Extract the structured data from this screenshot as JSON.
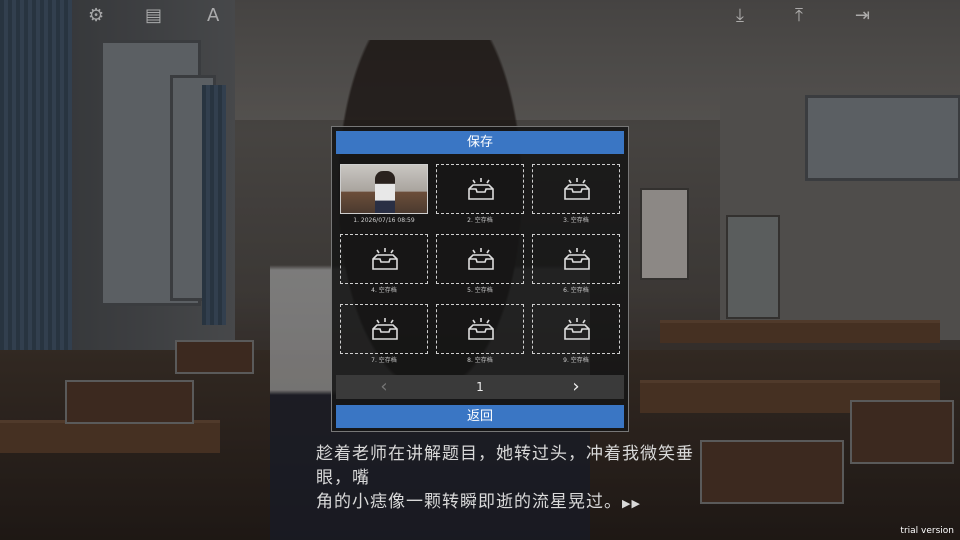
{
  "toolbar": {
    "left_icons": [
      "gear-icon",
      "message-log-icon",
      "font-icon"
    ],
    "right_icons": [
      "download-icon",
      "upload-icon",
      "exit-icon"
    ],
    "font_icon_glyph": "A"
  },
  "save_panel": {
    "title": "保存",
    "slots": [
      {
        "label": "1. 2026/07/16 08:59",
        "filled": true
      },
      {
        "label": "2. 空存档",
        "filled": false
      },
      {
        "label": "3. 空存档",
        "filled": false
      },
      {
        "label": "4. 空存档",
        "filled": false
      },
      {
        "label": "5. 空存档",
        "filled": false
      },
      {
        "label": "6. 空存档",
        "filled": false
      },
      {
        "label": "7. 空存档",
        "filled": false
      },
      {
        "label": "8. 空存档",
        "filled": false
      },
      {
        "label": "9. 空存档",
        "filled": false
      }
    ],
    "page": "1",
    "return_label": "返回"
  },
  "dialogue": {
    "line1": "趁着老师在讲解题目，她转过头，冲着我微笑垂眼，嘴",
    "line2": "角的小痣像一颗转瞬即逝的流星晃过。"
  },
  "watermark": "trial version"
}
